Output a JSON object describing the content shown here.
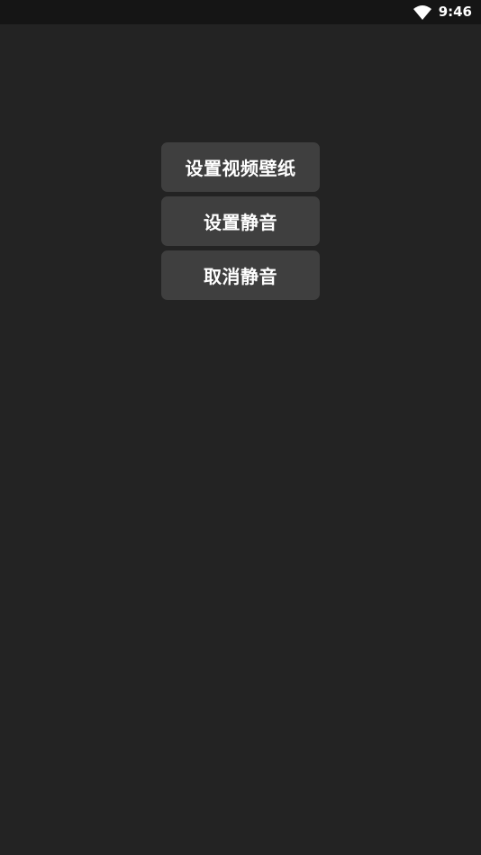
{
  "status_bar": {
    "time": "9:46",
    "wifi_icon": "wifi-icon"
  },
  "menu": {
    "items": [
      {
        "label": "设置视频壁纸"
      },
      {
        "label": "设置静音"
      },
      {
        "label": "取消静音"
      }
    ]
  },
  "colors": {
    "background": "#232323",
    "status_bar": "#151515",
    "button": "#3f3f3f",
    "text": "#ffffff"
  }
}
